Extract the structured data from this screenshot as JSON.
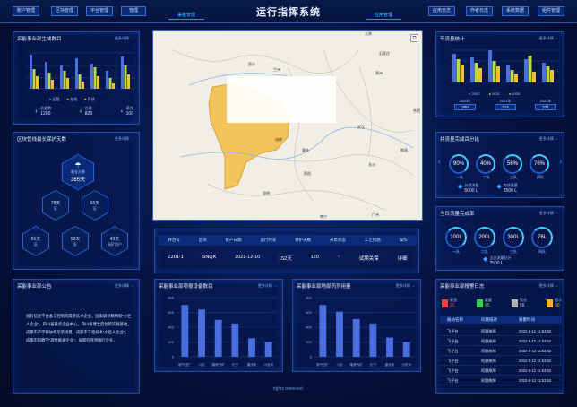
{
  "header": {
    "title": "运行指挥系统",
    "nav_left": [
      "账户管理",
      "区块管理",
      "平台管理",
      "管理"
    ],
    "tab_left": "采能管理",
    "tab_right": "应用管理",
    "nav_right": [
      "应用日志",
      "作者日志",
      "系统数据",
      "组件管理"
    ]
  },
  "panels": {
    "p1": {
      "title": "采能事业部生成数目",
      "more": "更多详情 →",
      "legend": [
        "运营",
        "在线",
        "离线"
      ],
      "stats": [
        {
          "label": "总量数",
          "value": "1200"
        },
        {
          "label": "在线",
          "value": "823"
        },
        {
          "label": "离线",
          "value": "100"
        }
      ]
    },
    "p2": {
      "title": "区块管线最长保护天数",
      "more": "更多详情 →",
      "center": {
        "label": "最长天数",
        "value": "365天"
      },
      "hexes": [
        {
          "value": "78天",
          "label": "区"
        },
        {
          "value": "65天",
          "label": "区"
        },
        {
          "value": "61天",
          "label": "区"
        },
        {
          "value": "58天",
          "label": "区"
        },
        {
          "value": "43天",
          "label": "采矿用户"
        }
      ]
    },
    "p3": {
      "title": "采能事业部公告",
      "more": "更多详情 →",
      "text": "国有信星平台备与控制的属新技术企业，国家级专精特新“小巨人企业”，四川省重点企业中心，四川省博士后创新实践基地，成都市产学研协作示范场景，成都市工程技术“小巨人企业”，成都市科教学“高性能通企业”，局新区连项服行企业。"
    },
    "p4": {
      "title": "采能事业部项报设备数目",
      "more": "更多详情 →"
    },
    "p5": {
      "title": "采能事业部地部药剂用量",
      "more": "更多详情 →"
    },
    "p6": {
      "title": "年流量统计",
      "more": "更多详情 →",
      "legend": [
        "2022",
        "2021",
        "2020"
      ],
      "badges": [
        {
          "label": "2020年",
          "value": "200"
        },
        {
          "label": "2021年",
          "value": "214"
        },
        {
          "label": "2022年",
          "value": "221"
        }
      ]
    },
    "p7": {
      "title": "井流量完成百分比",
      "more": "更多详情 →",
      "rings": [
        {
          "value": "90%",
          "label": "一队"
        },
        {
          "value": "40%",
          "label": "二队"
        },
        {
          "value": "56%",
          "label": "三队"
        },
        {
          "value": "76%",
          "label": "四队"
        }
      ],
      "stats": [
        {
          "label": "计划流量",
          "value": "5000 L"
        },
        {
          "label": "完成流量",
          "value": "2500 L"
        }
      ]
    },
    "p8": {
      "title": "当日流量完成率",
      "more": "更多详情 →",
      "rings": [
        {
          "value": "100L",
          "label": "一队"
        },
        {
          "value": "200L",
          "label": "二队"
        },
        {
          "value": "300L",
          "label": "三队"
        },
        {
          "value": "76L",
          "label": "四队"
        }
      ],
      "total": {
        "label": "当日流量总计",
        "value": "2500 L"
      }
    },
    "p9": {
      "title": "采能事业部报警日志",
      "more": "更多详情 →",
      "alerts": [
        {
          "label": "紧急",
          "value": "90",
          "color": "#ff3b3b"
        },
        {
          "label": "重要",
          "value": "45",
          "color": "#37d24a"
        },
        {
          "label": "警告",
          "value": "55",
          "color": "#b0b0b0"
        },
        {
          "label": "提示",
          "value": "50",
          "color": "#ffb020"
        }
      ],
      "cols": [
        "报站名称",
        "问题描述",
        "报警时间"
      ],
      "rows": [
        [
          "飞平台",
          "阿题故障",
          "2022-5-12 11:53:52"
        ],
        [
          "飞平台",
          "阿题故障",
          "2022-5-12 11:53:52"
        ],
        [
          "飞平台",
          "阿题故障",
          "2022-5-12 11:53:52"
        ],
        [
          "飞平台",
          "阿题故障",
          "2022-5-12 11:53:52"
        ],
        [
          "飞平台",
          "阿题故障",
          "2022-5-12 11:53:52"
        ],
        [
          "飞平台",
          "阿题故障",
          "2022-5-12 11:53:52"
        ]
      ]
    }
  },
  "map": {
    "cities": [
      "西宁",
      "兰州",
      "太原",
      "石家庄",
      "郑州",
      "成都",
      "重庆",
      "武汉",
      "南昌",
      "长沙",
      "贵阳",
      "昆明",
      "南宁",
      "广州",
      "合肥"
    ]
  },
  "table": {
    "cols": [
      "井台号",
      "区块",
      "投产日期",
      "运行时长",
      "保护天数",
      "开泵状态",
      "工艺措施",
      "操作"
    ],
    "row": [
      "Z201-1",
      "SNQK",
      "2021-12-10",
      "152天",
      "120",
      "×",
      "试期关保",
      "详细"
    ]
  },
  "footer": "rights reserved.",
  "chart_data": [
    {
      "type": "bar",
      "title": "采能事业部项报设备数目",
      "categories": [
        "新气田厂",
        "川庆",
        "隆港气矿",
        "长宁",
        "重庆司",
        "川页司"
      ],
      "series": [
        {
          "values": [
            700,
            640,
            500,
            450,
            250,
            200
          ]
        }
      ],
      "ylim": [
        0,
        800
      ]
    },
    {
      "type": "bar",
      "title": "采能事业部地部药剂用量",
      "categories": [
        "新气田厂",
        "川庆",
        "隆港气矿",
        "长宁",
        "重庆司",
        "川页司"
      ],
      "series": [
        {
          "values": [
            700,
            610,
            510,
            450,
            260,
            200
          ]
        }
      ],
      "ylim": [
        0,
        800
      ]
    }
  ],
  "colors": {
    "accent": "#3ea0ff",
    "bar": "#4a6ee0",
    "map_fill": "#f3c45a"
  }
}
